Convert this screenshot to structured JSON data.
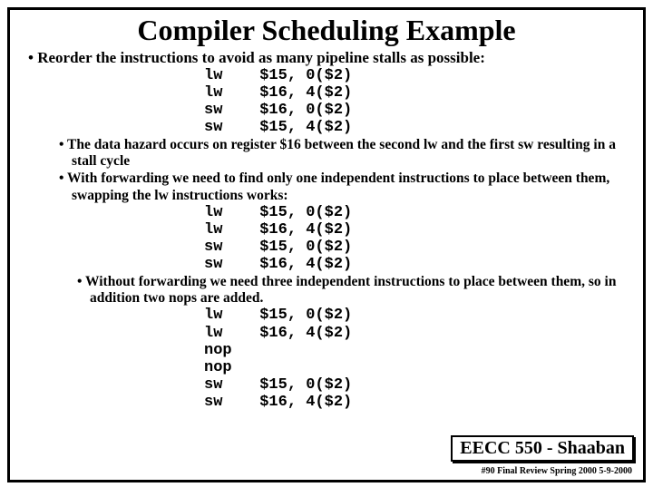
{
  "title": "Compiler Scheduling Example",
  "p1": "Reorder the instructions to avoid as many pipeline stalls as possible:",
  "code1": "lw    $15, 0($2)\nlw    $16, 4($2)\nsw    $16, 0($2)\nsw    $15, 4($2)",
  "p2": "The data hazard occurs on register $16 between the second lw and the first sw resulting in a stall cycle",
  "p3": "With forwarding we need to find only one independent instructions to place between them, swapping the lw instructions works:",
  "code2": "lw    $15, 0($2)\nlw    $16, 4($2)\nsw    $15, 0($2)\nsw    $16, 4($2)",
  "p4": "Without forwarding we need three independent instructions to place between them,  so in addition two nops are added.",
  "code3": "lw    $15, 0($2)\nlw    $16, 4($2)\nnop\nnop\nsw    $15, 0($2)\nsw    $16, 4($2)",
  "footer_box": "EECC 550 - Shaaban",
  "footer_small": "#90   Final  Review    Spring 2000   5-9-2000"
}
